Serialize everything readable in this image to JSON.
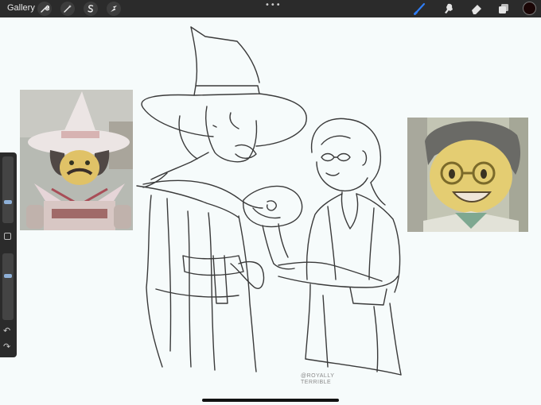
{
  "topbar": {
    "gallery_label": "Gallery",
    "left_tools": [
      "wrench-icon",
      "magic-wand-icon",
      "selection-icon",
      "transform-arrow-icon"
    ],
    "menu_dots": "•••",
    "right_tools": [
      "brush-icon",
      "smudge-icon",
      "eraser-icon",
      "layers-icon"
    ],
    "active_tool_color": "#2f7df5",
    "current_color": "#1a0606"
  },
  "sidebar": {
    "brush_size_level": 0.75,
    "opacity_level": 0.65,
    "undo_glyph": "↶",
    "redo_glyph": "↷"
  },
  "canvas": {
    "watermark": "@ROYALLY TERRIBLE"
  }
}
